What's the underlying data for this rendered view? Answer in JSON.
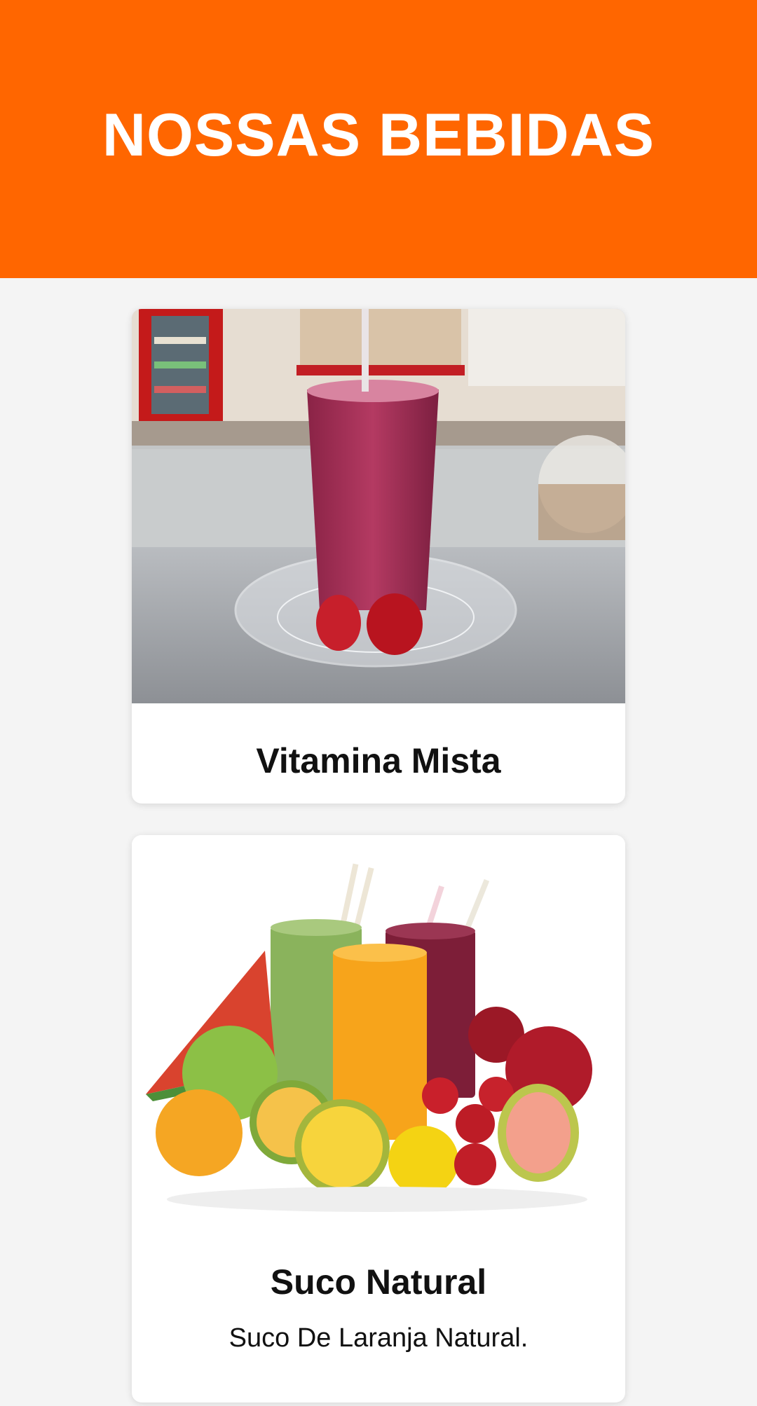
{
  "header": {
    "title": "NOSSAS BEBIDAS"
  },
  "items": [
    {
      "name": "Vitamina Mista",
      "description": "",
      "image_icon": "smoothie-photo"
    },
    {
      "name": "Suco Natural",
      "description": "Suco De Laranja Natural.",
      "image_icon": "juice-fruits-photo"
    }
  ],
  "colors": {
    "header_bg": "#ff6600",
    "page_bg": "#f4f4f4",
    "card_bg": "#ffffff"
  }
}
